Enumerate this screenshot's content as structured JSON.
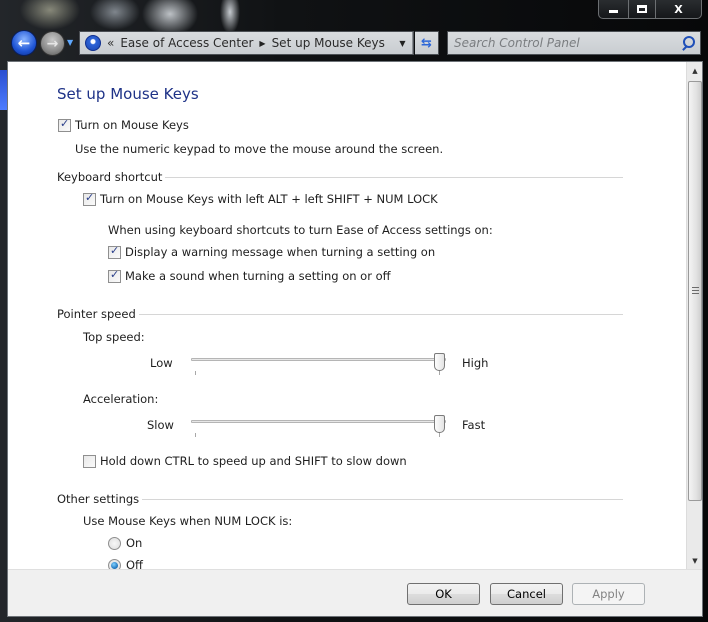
{
  "window": {
    "caption_buttons": {
      "minimize_icon": "minimize-icon",
      "maximize_icon": "maximize-icon",
      "close_label": "X"
    }
  },
  "navigation": {
    "back_glyph": "←",
    "forward_glyph": "→",
    "history_dropdown_glyph": "▼",
    "breadcrumb": {
      "overflow_glyph": "«",
      "items": [
        "Ease of Access Center",
        "Set up Mouse Keys"
      ],
      "separator_glyph": "▶",
      "dropdown_glyph": "▼"
    },
    "refresh_glyph": "⇆",
    "search": {
      "placeholder": "Search Control Panel",
      "value": ""
    }
  },
  "page": {
    "title": "Set up Mouse Keys",
    "turn_on_mouse_keys": {
      "label": "Turn on Mouse Keys",
      "checked": true,
      "description": "Use the numeric keypad to move the mouse around the screen."
    },
    "keyboard_shortcut": {
      "header": "Keyboard shortcut",
      "shortcut_option": {
        "label": "Turn on Mouse Keys with left ALT + left SHIFT + NUM LOCK",
        "checked": true
      },
      "sub_header": "When using keyboard shortcuts to turn Ease of Access settings on:",
      "warning_option": {
        "label": "Display a warning message when turning a setting on",
        "checked": true
      },
      "sound_option": {
        "label": "Make a sound when turning a setting on or off",
        "checked": true
      }
    },
    "pointer_speed": {
      "header": "Pointer speed",
      "top_speed": {
        "label": "Top speed:",
        "min_label": "Low",
        "max_label": "High",
        "value_fraction": 1.0
      },
      "acceleration": {
        "label": "Acceleration:",
        "min_label": "Slow",
        "max_label": "Fast",
        "value_fraction": 1.0
      },
      "ctrl_shift_option": {
        "label": "Hold down CTRL to speed up and SHIFT to slow down",
        "checked": false
      }
    },
    "other_settings": {
      "header": "Other settings",
      "num_lock_label": "Use Mouse Keys when NUM LOCK is:",
      "options": [
        {
          "label": "On",
          "selected": false
        },
        {
          "label": "Off",
          "selected": true
        }
      ]
    }
  },
  "footer": {
    "ok_label": "OK",
    "cancel_label": "Cancel",
    "apply_label": "Apply",
    "apply_enabled": false
  }
}
